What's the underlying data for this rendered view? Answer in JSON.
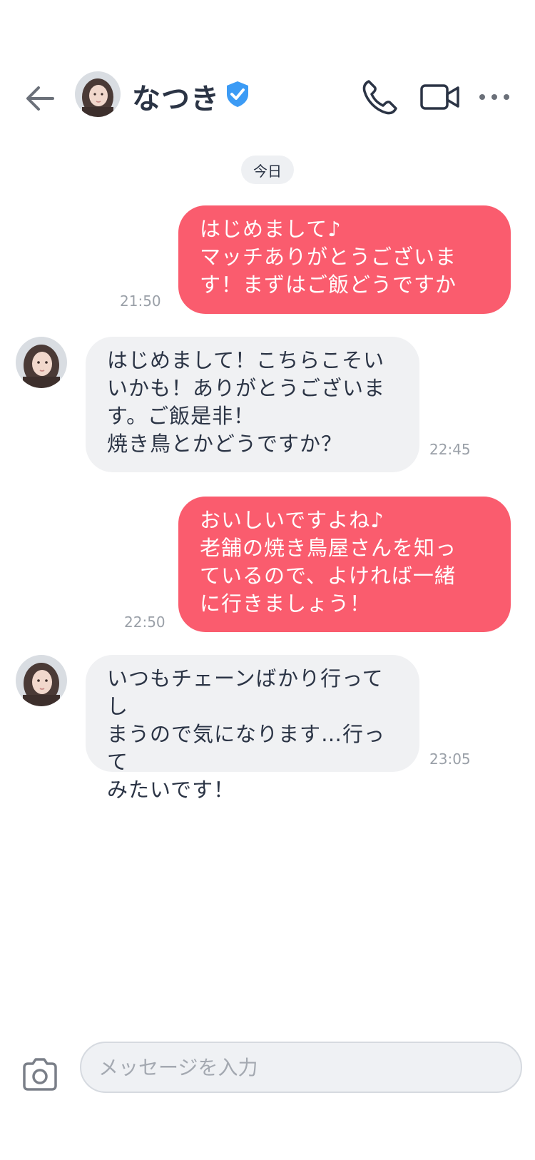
{
  "header": {
    "contact_name": "なつき",
    "icons": {
      "back": "arrow-left-icon",
      "verified": "verified-badge-icon",
      "call": "phone-icon",
      "video": "video-camera-icon",
      "more": "more-horizontal-icon"
    }
  },
  "date_divider": "今日",
  "messages": [
    {
      "direction": "out",
      "text": "はじめまして♪\nマッチありがとうございま\nす！まずはご飯どうですか",
      "time": "21:50"
    },
    {
      "direction": "in",
      "text": "はじめまして！こちらこそい\nいかも！ありがとうございま\nす。ご飯是非！\n焼き鳥とかどうですか？",
      "time": "22:45"
    },
    {
      "direction": "out",
      "text": "おいしいですよね♪\n老舗の焼き鳥屋さんを知っ\nているので、よければ一緒\nに行きましょう！",
      "time": "22:50"
    },
    {
      "direction": "in",
      "text": "いつもチェーンばかり行ってし\nまうので気になります…行って\nみたいです！",
      "time": "23:05"
    }
  ],
  "composer": {
    "placeholder": "メッセージを入力",
    "camera_icon": "camera-icon"
  },
  "colors": {
    "outgoing_bubble": "#fa5c6e",
    "incoming_bubble": "#f0f1f3",
    "verified_badge": "#3c9bf5",
    "text": "#2b3445"
  }
}
